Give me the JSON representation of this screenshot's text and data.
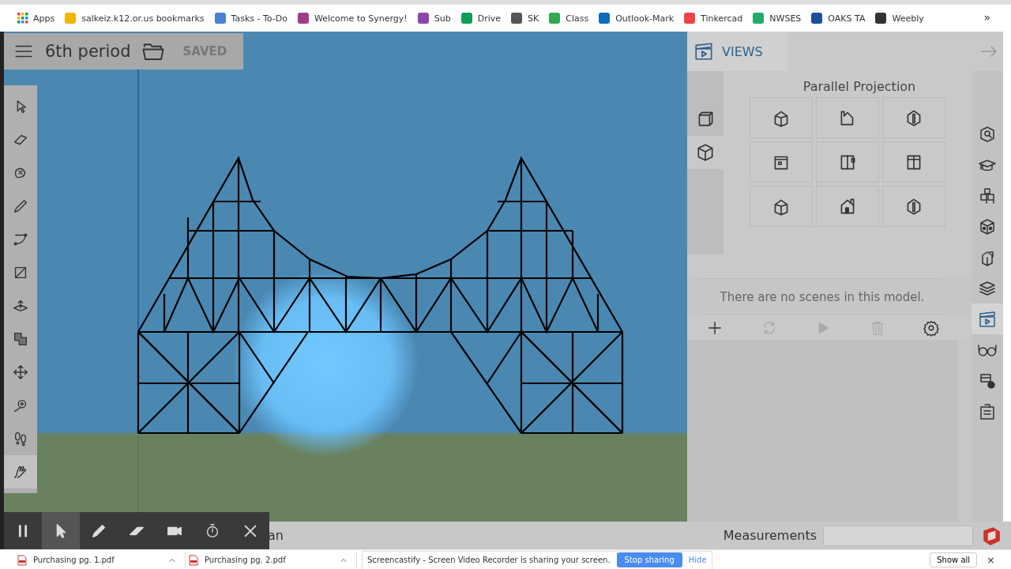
{
  "bookmarks": {
    "items": [
      {
        "label": "Apps"
      },
      {
        "label": "salkeiz.k12.or.us bookmarks"
      },
      {
        "label": "Tasks - To-Do"
      },
      {
        "label": "Welcome to Synergy!"
      },
      {
        "label": "Sub"
      },
      {
        "label": "Drive"
      },
      {
        "label": "SK"
      },
      {
        "label": "Class"
      },
      {
        "label": "Outlook-Mark"
      },
      {
        "label": "Tinkercad"
      },
      {
        "label": "NWSES"
      },
      {
        "label": "OAKS TA"
      },
      {
        "label": "Weebly"
      }
    ],
    "more": "»"
  },
  "model": {
    "title": "6th period",
    "status": "SAVED"
  },
  "tools": [
    {
      "kind": "select",
      "selected": false
    },
    {
      "kind": "eraser",
      "selected": false
    },
    {
      "kind": "paint",
      "selected": false
    },
    {
      "kind": "pencil",
      "selected": false
    },
    {
      "kind": "arc",
      "selected": false
    },
    {
      "kind": "rectangle",
      "selected": false
    },
    {
      "kind": "pushpull",
      "selected": false
    },
    {
      "kind": "offset",
      "selected": false
    },
    {
      "kind": "move",
      "selected": false
    },
    {
      "kind": "tape",
      "selected": false
    },
    {
      "kind": "walk",
      "selected": false
    },
    {
      "kind": "pan",
      "selected": true
    }
  ],
  "views_panel": {
    "title": "VIEWS",
    "section": "Parallel Projection",
    "view_tabs": [
      {
        "kind": "parallel",
        "selected": false
      },
      {
        "kind": "perspective",
        "selected": true
      }
    ],
    "views": [
      {
        "kind": "iso"
      },
      {
        "kind": "front"
      },
      {
        "kind": "top"
      },
      {
        "kind": "plan"
      },
      {
        "kind": "side"
      },
      {
        "kind": "back"
      },
      {
        "kind": "iso"
      },
      {
        "kind": "elevation"
      },
      {
        "kind": "top"
      }
    ],
    "empty_message": "There are no scenes in this model.",
    "actions": [
      {
        "kind": "add",
        "disabled": false
      },
      {
        "kind": "update",
        "disabled": true
      },
      {
        "kind": "play",
        "disabled": true
      },
      {
        "kind": "delete",
        "disabled": true
      },
      {
        "kind": "settings",
        "disabled": false
      }
    ]
  },
  "tray": [
    {
      "kind": "entity",
      "selected": false
    },
    {
      "kind": "instructor",
      "selected": false
    },
    {
      "kind": "components",
      "selected": false
    },
    {
      "kind": "materials",
      "selected": false
    },
    {
      "kind": "styles",
      "selected": false
    },
    {
      "kind": "layers",
      "selected": false
    },
    {
      "kind": "scenes",
      "selected": true
    },
    {
      "kind": "display",
      "selected": false
    },
    {
      "kind": "solid",
      "selected": false
    },
    {
      "kind": "outliner",
      "selected": false
    }
  ],
  "status_bar": {
    "hint": "an",
    "measurements_label": "Measurements"
  },
  "recorder": {
    "buttons": [
      {
        "kind": "pause",
        "selected": false
      },
      {
        "kind": "pointer",
        "selected": true
      },
      {
        "kind": "pen",
        "selected": false
      },
      {
        "kind": "eraser",
        "selected": false
      },
      {
        "kind": "camera",
        "selected": false
      },
      {
        "kind": "timer",
        "selected": false
      },
      {
        "kind": "close",
        "selected": false
      }
    ]
  },
  "downloads": {
    "files": [
      {
        "name": "Purchasing pg. 1.pdf"
      },
      {
        "name": "Purchasing pg. 2.pdf"
      }
    ],
    "sharing": {
      "message": "Screencastify - Screen Video Recorder is sharing your screen.",
      "stop": "Stop sharing",
      "hide": "Hide"
    },
    "show_all": "Show all",
    "close": "×"
  }
}
